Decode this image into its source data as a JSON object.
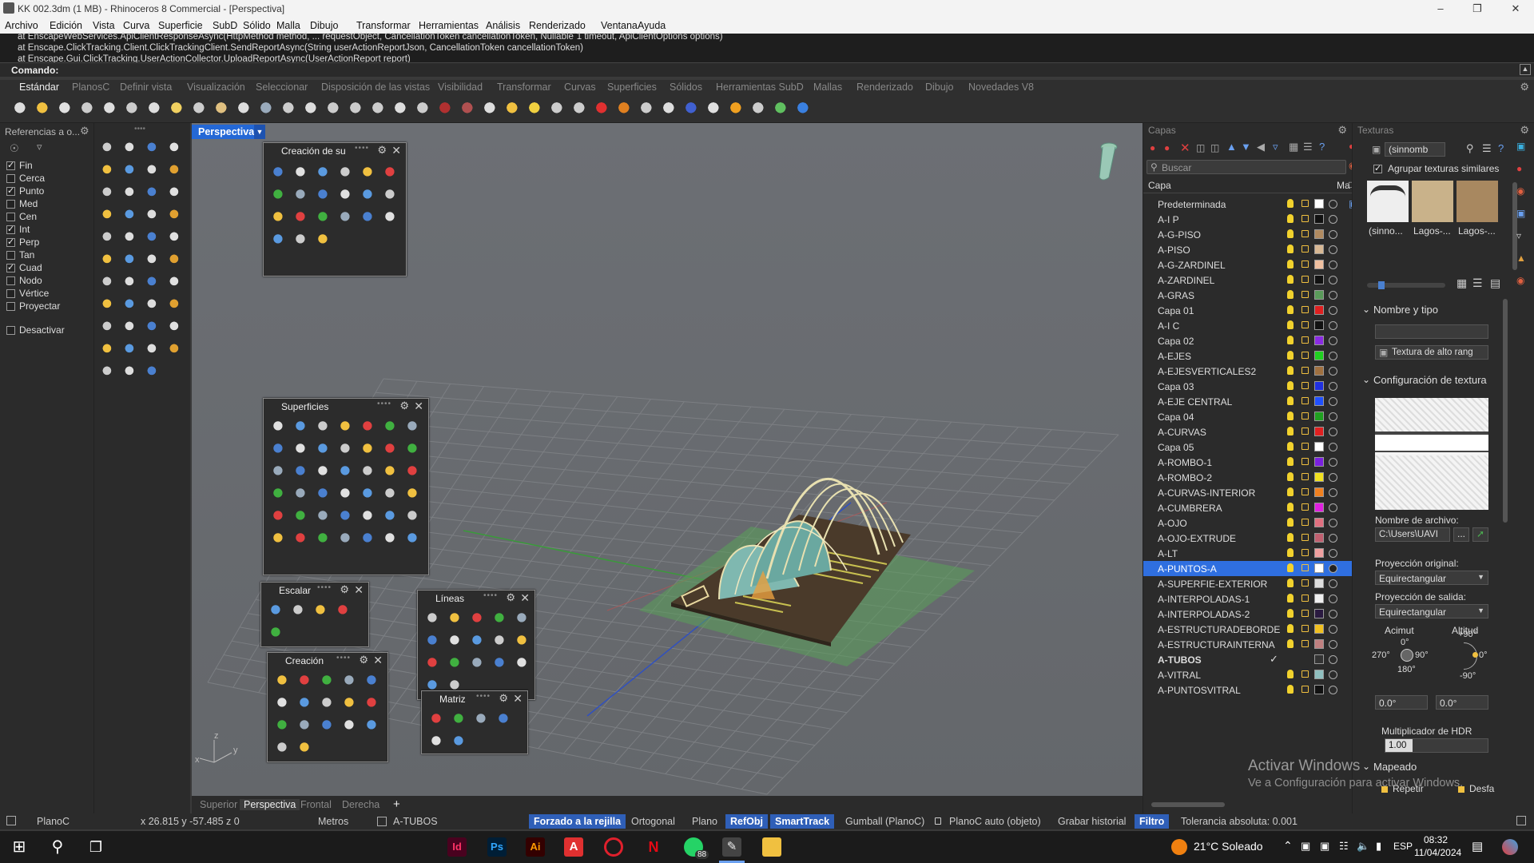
{
  "window": {
    "title": "KK 002.3dm (1 MB) - Rhinoceros 8 Commercial - [Perspectiva]"
  },
  "menu": [
    "Archivo",
    "Edición",
    "Vista",
    "Curva",
    "Superficie",
    "SubD",
    "Sólido",
    "Malla",
    "Dibujo",
    "Transformar",
    "Herramientas",
    "Análisis",
    "Renderizado",
    "Ventana",
    "Ayuda"
  ],
  "command_history": [
    "at EnscapeWebServices.ApiClientResponseAsync(HttpMethod method, ... requestObject, CancellationToken cancellationToken, Nullable`1 timeout, ApiClientOptions options)",
    "at Enscape.ClickTracking.Client.ClickTrackingClient.SendReportAsync(String userActionReportJson, CancellationToken cancellationToken)",
    "at Enscape.Gui.ClickTracking.UserActionCollector.UploadReportAsync(UserActionReport report)"
  ],
  "command_prompt": "Comando:",
  "toolbar_tabs": [
    "Estándar",
    "PlanosC",
    "Definir vista",
    "Visualización",
    "Seleccionar",
    "Disposición de las vistas",
    "Visibilidad",
    "Transformar",
    "Curvas",
    "Superficies",
    "Sólidos",
    "Herramientas SubD",
    "Mallas",
    "Renderizado",
    "Dibujo",
    "Novedades V8"
  ],
  "osnap": {
    "title": "Referencias a o...",
    "items": [
      {
        "label": "Fin",
        "checked": true
      },
      {
        "label": "Cerca",
        "checked": false
      },
      {
        "label": "Punto",
        "checked": true
      },
      {
        "label": "Med",
        "checked": false
      },
      {
        "label": "Cen",
        "checked": false
      },
      {
        "label": "Int",
        "checked": true
      },
      {
        "label": "Perp",
        "checked": true
      },
      {
        "label": "Tan",
        "checked": false
      },
      {
        "label": "Cuad",
        "checked": true
      },
      {
        "label": "Nodo",
        "checked": false
      },
      {
        "label": "Vértice",
        "checked": false
      },
      {
        "label": "Proyectar",
        "checked": false
      }
    ],
    "disable": "Desactivar"
  },
  "viewport": {
    "name": "Perspectiva"
  },
  "palettes": {
    "creacion_sup": "Creación de su",
    "superficies": "Superficies",
    "escalar": "Escalar",
    "lineas": "Líneas",
    "creacion": "Creación",
    "matriz": "Matriz"
  },
  "view_tabs": [
    "Superior",
    "Perspectiva",
    "Frontal",
    "Derecha"
  ],
  "layers": {
    "panel_title": "Capas",
    "search_placeholder": "Buscar",
    "col_layer": "Capa",
    "col_m": "Ma",
    "rows": [
      {
        "name": "Predeterminada",
        "color": "#ffffff"
      },
      {
        "name": "A-I P",
        "color": "#111111"
      },
      {
        "name": "A-G-PISO",
        "color": "#b08a60"
      },
      {
        "name": "A-PISO",
        "color": "#d8b894"
      },
      {
        "name": "A-G-ZARDINEL",
        "color": "#f0c0a0"
      },
      {
        "name": "A-ZARDINEL",
        "color": "#111111"
      },
      {
        "name": "A-GRAS",
        "color": "#5a9a5a"
      },
      {
        "name": "Capa 01",
        "color": "#e02020"
      },
      {
        "name": "A-I C",
        "color": "#111111"
      },
      {
        "name": "Capa 02",
        "color": "#8a2be2"
      },
      {
        "name": "A-EJES",
        "color": "#20d020"
      },
      {
        "name": "A-EJESVERTICALES2",
        "color": "#a07040"
      },
      {
        "name": "Capa 03",
        "color": "#2030e0"
      },
      {
        "name": "A-EJE CENTRAL",
        "color": "#2050ff"
      },
      {
        "name": "Capa 04",
        "color": "#20a020"
      },
      {
        "name": "A-CURVAS",
        "color": "#e02020"
      },
      {
        "name": "Capa 05",
        "color": "#ffffff"
      },
      {
        "name": "A-ROMBO-1",
        "color": "#7a20e0"
      },
      {
        "name": "A-ROMBO-2",
        "color": "#f0e020"
      },
      {
        "name": "A-CURVAS-INTERIOR",
        "color": "#f08020"
      },
      {
        "name": "A-CUMBRERA",
        "color": "#e020e0"
      },
      {
        "name": "A-OJO",
        "color": "#e07080"
      },
      {
        "name": "A-OJO-EXTRUDE",
        "color": "#c06070"
      },
      {
        "name": "A-LT",
        "color": "#f0a0a0"
      },
      {
        "name": "A-PUNTOS-A",
        "color": "#ffffff",
        "selected": true
      },
      {
        "name": "A-SUPERFIE-EXTERIOR",
        "color": "#dddddd"
      },
      {
        "name": "A-INTERPOLADAS-1",
        "color": "#f0f0f0"
      },
      {
        "name": "A-INTERPOLADAS-2",
        "color": "#2a1a40"
      },
      {
        "name": "A-ESTRUCTURADEBORDE",
        "color": "#f0c020"
      },
      {
        "name": "A-ESTRUCTURAINTERNA",
        "color": "#c08080"
      },
      {
        "name": "A-TUBOS",
        "color": "#333333",
        "current": true
      },
      {
        "name": "A-VITRAL",
        "color": "#90c0c0"
      },
      {
        "name": "A-PUNTOSVITRAL",
        "color": "#111111"
      }
    ]
  },
  "textures": {
    "panel_title": "Texturas",
    "current": "(sinnomb",
    "group_similar": "Agrupar texturas similares",
    "thumbs": [
      "(sinno...",
      "Lagos-...",
      "Lagos-..."
    ],
    "section_name": "Nombre y tipo",
    "type_value": "Textura de alto rang",
    "section_config": "Configuración de textura",
    "filename_label": "Nombre de archivo:",
    "filename_value": "C:\\Users\\UAVI",
    "orig_proj_label": "Proyección original:",
    "orig_proj_value": "Equirectangular",
    "out_proj_label": "Proyección de salida:",
    "out_proj_value": "Equirectangular",
    "azimuth_label": "Acimut",
    "altitude_label": "Altitud",
    "az_0": "0°",
    "az_90": "90°",
    "az_180": "180°",
    "az_270": "270°",
    "alt_p90": "+90°",
    "alt_0": "0°",
    "alt_m90": "-90°",
    "az_value": "0.0°",
    "alt_value": "0.0°",
    "hdr_label": "Multiplicador de HDR",
    "hdr_value": "1.00",
    "section_mapping": "Mapeado",
    "repeat": "Repetir",
    "offset": "Desfa"
  },
  "watermark": {
    "line1": "Activar Windows",
    "line2": "Ve a Configuración para activar Windows."
  },
  "status": {
    "cplane": "PlanoC",
    "coords": "x 26.815   y -57.485   z 0",
    "units": "Metros",
    "layer": "A-TUBOS",
    "snap": "Forzado a la rejilla",
    "ortho": "Ortogonal",
    "planar": "Plano",
    "osnap": "RefObj",
    "smarttrack": "SmartTrack",
    "gumball": "Gumball (PlanoC)",
    "autocplane": "PlanoC auto (objeto)",
    "history": "Grabar historial",
    "filter": "Filtro",
    "tolerance": "Tolerancia absoluta: 0.001"
  },
  "taskbar": {
    "weather": "21°C  Soleado",
    "lang": "ESP",
    "time": "08:32",
    "date": "11/04/2024",
    "badge": "88"
  }
}
